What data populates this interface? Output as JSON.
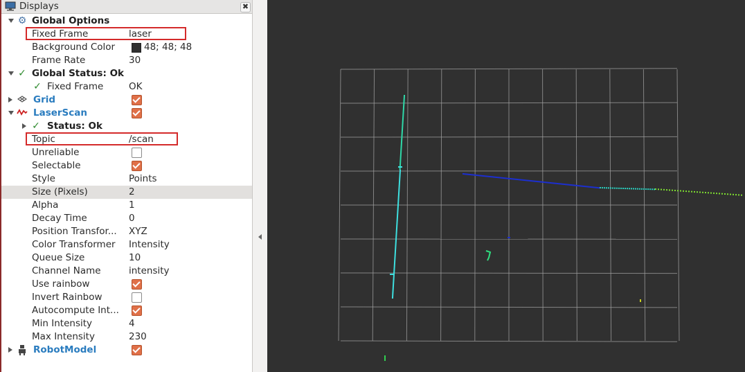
{
  "panel": {
    "title": "Displays",
    "close_label": "✖"
  },
  "tree": [
    {
      "name": "Global Options",
      "kind": "group",
      "icon": "gear-icon"
    },
    {
      "name": "Fixed Frame",
      "value": "laser",
      "kind": "prop"
    },
    {
      "name": "Background Color",
      "value": "48; 48; 48",
      "kind": "color",
      "color": "#303030"
    },
    {
      "name": "Frame Rate",
      "value": "30",
      "kind": "prop"
    },
    {
      "name": "Global Status: Ok",
      "kind": "status"
    },
    {
      "name": "Fixed Frame",
      "value": "OK",
      "kind": "statuschild"
    },
    {
      "name": "Grid",
      "kind": "display",
      "checked": true,
      "icon": "grid-icon"
    },
    {
      "name": "LaserScan",
      "kind": "display",
      "checked": true,
      "icon": "laserscan-icon"
    },
    {
      "name": "Status: Ok",
      "kind": "substatus"
    },
    {
      "name": "Topic",
      "value": "/scan",
      "kind": "prop"
    },
    {
      "name": "Unreliable",
      "checked": false,
      "kind": "check"
    },
    {
      "name": "Selectable",
      "checked": true,
      "kind": "check"
    },
    {
      "name": "Style",
      "value": "Points",
      "kind": "prop"
    },
    {
      "name": "Size (Pixels)",
      "value": "2",
      "kind": "prop",
      "selected": true
    },
    {
      "name": "Alpha",
      "value": "1",
      "kind": "prop"
    },
    {
      "name": "Decay Time",
      "value": "0",
      "kind": "prop"
    },
    {
      "name": "Position Transfor...",
      "value": "XYZ",
      "kind": "prop"
    },
    {
      "name": "Color Transformer",
      "value": "Intensity",
      "kind": "prop"
    },
    {
      "name": "Queue Size",
      "value": "10",
      "kind": "prop"
    },
    {
      "name": "Channel Name",
      "value": "intensity",
      "kind": "prop"
    },
    {
      "name": "Use rainbow",
      "checked": true,
      "kind": "check"
    },
    {
      "name": "Invert Rainbow",
      "checked": false,
      "kind": "check"
    },
    {
      "name": "Autocompute Int...",
      "checked": true,
      "kind": "check"
    },
    {
      "name": "Min Intensity",
      "value": "4",
      "kind": "prop"
    },
    {
      "name": "Max Intensity",
      "value": "230",
      "kind": "prop"
    },
    {
      "name": "RobotModel",
      "kind": "display",
      "checked": true,
      "icon": "robot-icon"
    }
  ],
  "colors": {
    "background": "#303030",
    "grid": "#a0a0a0",
    "highlight": "#d42a2a",
    "checkbox": "#e07048",
    "display_name": "#2a7cbf"
  }
}
